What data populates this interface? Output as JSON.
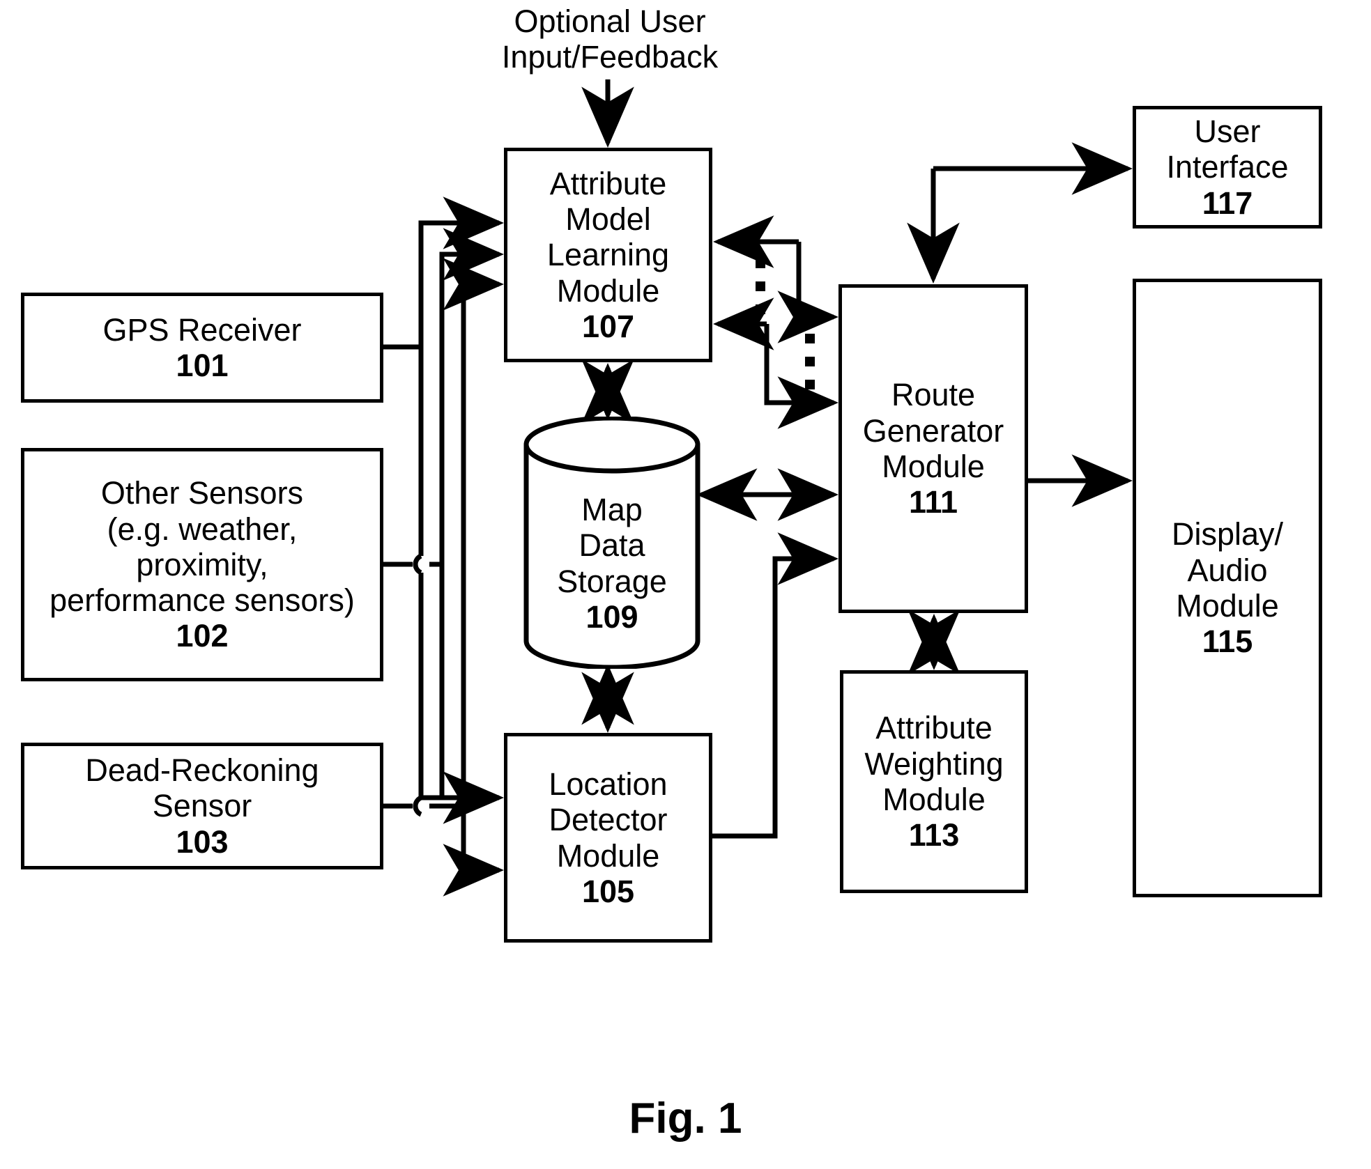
{
  "figure": {
    "caption": "Fig. 1",
    "annotation": "Optional User\nInput/Feedback"
  },
  "nodes": {
    "gps_receiver": {
      "label": "GPS Receiver",
      "ref": "101"
    },
    "other_sensors": {
      "label": "Other Sensors\n(e.g. weather,\nproximity,\nperformance sensors)",
      "ref": "102"
    },
    "dead_reckoning": {
      "label": "Dead-Reckoning\nSensor",
      "ref": "103"
    },
    "location_detector": {
      "label": "Location\nDetector\nModule",
      "ref": "105"
    },
    "attribute_model_learning": {
      "label": "Attribute\nModel\nLearning\nModule",
      "ref": "107"
    },
    "map_data_storage": {
      "label": "Map\nData\nStorage",
      "ref": "109"
    },
    "route_generator": {
      "label": "Route\nGenerator\nModule",
      "ref": "111"
    },
    "attribute_weighting": {
      "label": "Attribute\nWeighting\nModule",
      "ref": "113"
    },
    "display_audio": {
      "label": "Display/\nAudio\nModule",
      "ref": "115"
    },
    "user_interface": {
      "label": "User\nInterface",
      "ref": "117"
    }
  },
  "style": {
    "stroke": "#000000",
    "fill": "#ffffff"
  },
  "chart_data": {
    "type": "diagram",
    "title": "Fig. 1",
    "blocks": [
      {
        "id": "101",
        "name": "GPS Receiver"
      },
      {
        "id": "102",
        "name": "Other Sensors (e.g. weather, proximity, performance sensors)"
      },
      {
        "id": "103",
        "name": "Dead-Reckoning Sensor"
      },
      {
        "id": "105",
        "name": "Location Detector Module"
      },
      {
        "id": "107",
        "name": "Attribute Model Learning Module"
      },
      {
        "id": "109",
        "name": "Map Data Storage",
        "shape": "cylinder"
      },
      {
        "id": "111",
        "name": "Route Generator Module"
      },
      {
        "id": "113",
        "name": "Attribute Weighting Module"
      },
      {
        "id": "115",
        "name": "Display/Audio Module"
      },
      {
        "id": "117",
        "name": "User Interface"
      }
    ],
    "edges": [
      {
        "from": "Optional User Input/Feedback",
        "to": "107",
        "style": "solid",
        "arrow": "single"
      },
      {
        "from": "101",
        "to": "107",
        "style": "solid",
        "arrow": "single"
      },
      {
        "from": "102",
        "to": "107",
        "style": "solid",
        "arrow": "single"
      },
      {
        "from": "103",
        "to": "107",
        "style": "solid",
        "arrow": "single"
      },
      {
        "from": "101",
        "to": "105",
        "style": "solid",
        "arrow": "single"
      },
      {
        "from": "102",
        "to": "105",
        "style": "solid",
        "arrow": "single"
      },
      {
        "from": "103",
        "to": "105",
        "style": "solid",
        "arrow": "single"
      },
      {
        "from": "107",
        "to": "109",
        "style": "solid",
        "arrow": "double"
      },
      {
        "from": "109",
        "to": "105",
        "style": "solid",
        "arrow": "double"
      },
      {
        "from": "109",
        "to": "111",
        "style": "solid",
        "arrow": "double"
      },
      {
        "from": "111",
        "to": "107",
        "style": "dotted",
        "arrow": "single"
      },
      {
        "from": "107",
        "to": "111",
        "style": "dotted",
        "arrow": "single"
      },
      {
        "from": "105",
        "to": "111",
        "style": "solid",
        "arrow": "single"
      },
      {
        "from": "111",
        "to": "117",
        "style": "solid",
        "arrow": "single"
      },
      {
        "from": "117",
        "to": "111",
        "style": "solid",
        "arrow": "single"
      },
      {
        "from": "111",
        "to": "113",
        "style": "solid",
        "arrow": "double"
      },
      {
        "from": "111",
        "to": "115",
        "style": "solid",
        "arrow": "single"
      }
    ]
  }
}
